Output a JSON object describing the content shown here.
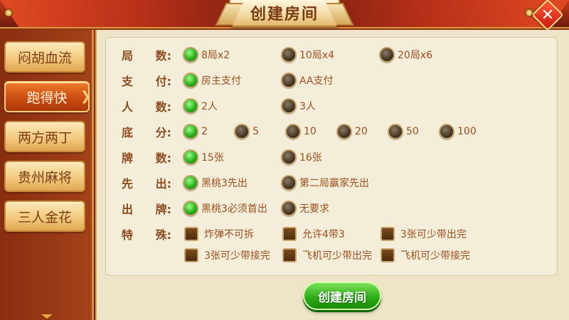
{
  "header": {
    "title": "创建房间",
    "close_label": "✕"
  },
  "sidebar": {
    "items": [
      {
        "label": "闷胡血流",
        "active": false
      },
      {
        "label": "跑得快",
        "active": true
      },
      {
        "label": "两方两丁",
        "active": false
      },
      {
        "label": "贵州麻将",
        "active": false
      },
      {
        "label": "三人金花",
        "active": false
      }
    ]
  },
  "options": {
    "rounds": {
      "label_1": "局",
      "label_2": "数:",
      "choices": [
        "8局x2",
        "10局x4",
        "20局x6"
      ],
      "selected": 0
    },
    "payment": {
      "label_1": "支",
      "label_2": "付:",
      "choices": [
        "房主支付",
        "AA支付"
      ],
      "selected": 0
    },
    "players": {
      "label_1": "人",
      "label_2": "数:",
      "choices": [
        "2人",
        "3人"
      ],
      "selected": 0
    },
    "base": {
      "label_1": "底",
      "label_2": "分:",
      "choices": [
        "2",
        "5",
        "10",
        "20",
        "50",
        "100"
      ],
      "selected": 0
    },
    "cards": {
      "label_1": "牌",
      "label_2": "数:",
      "choices": [
        "15张",
        "16张"
      ],
      "selected": 0
    },
    "first": {
      "label_1": "先",
      "label_2": "出:",
      "choices": [
        "黑桃3先出",
        "第二局赢家先出"
      ],
      "selected": 0
    },
    "play": {
      "label_1": "出",
      "label_2": "牌:",
      "choices": [
        "黑桃3必须首出",
        "无要求"
      ],
      "selected": 0
    },
    "special": {
      "label_1": "特",
      "label_2": "殊:",
      "choices": [
        "炸弹不可拆",
        "允许4带3",
        "3张可少带出完",
        "3张可少带接完",
        "飞机可少带出完",
        "飞机可少带接完"
      ]
    }
  },
  "actions": {
    "create_label": "创建房间"
  }
}
